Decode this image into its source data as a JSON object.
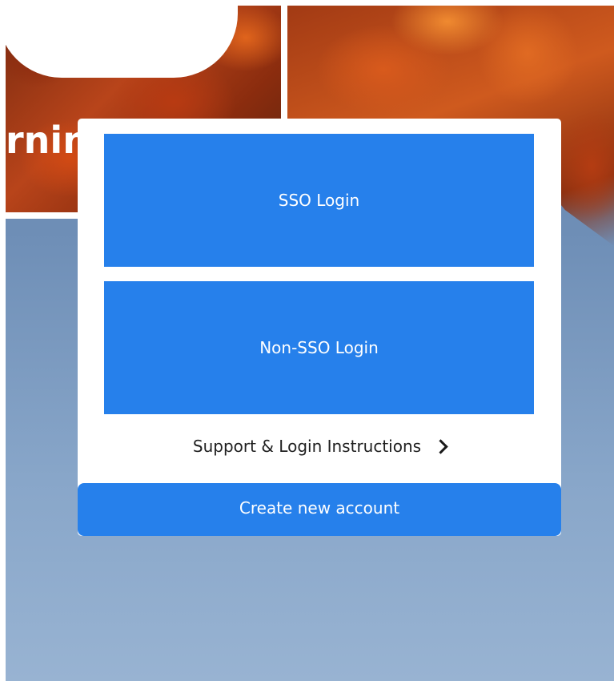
{
  "background": {
    "brand_text": "rnin",
    "sky_color": "#6f8fb7",
    "leaf_color": "#c94a18"
  },
  "login_card": {
    "sso_button_label": "SSO Login",
    "non_sso_button_label": "Non-SSO Login",
    "support_link_label": "Support & Login Instructions",
    "support_link_icon": "chevron-right-icon",
    "create_account_label": "Create new account",
    "accent_color": "#2680eb"
  }
}
